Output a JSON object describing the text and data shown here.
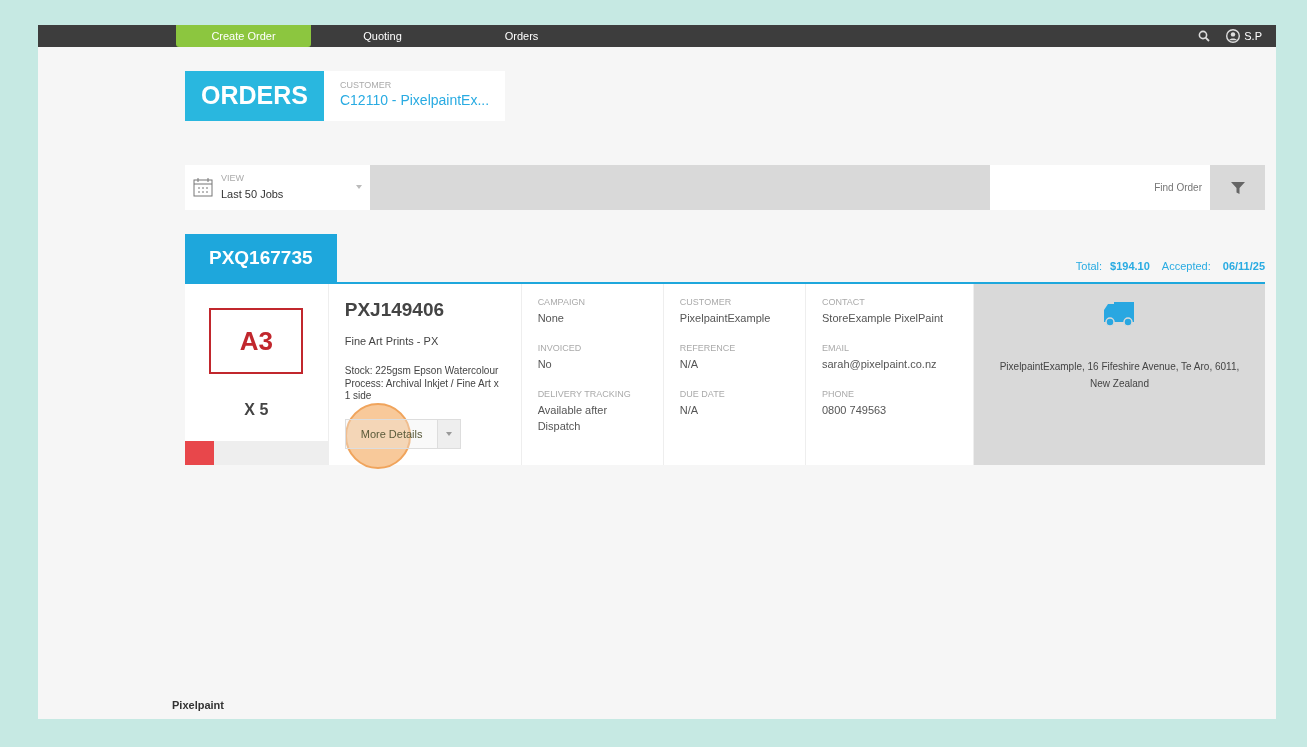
{
  "nav": {
    "items": [
      {
        "label": "Create Order",
        "selected": true
      },
      {
        "label": "Quoting",
        "selected": false
      },
      {
        "label": "Orders",
        "selected": false
      }
    ],
    "user": "S.P"
  },
  "header": {
    "title": "ORDERS",
    "customer_label": "CUSTOMER",
    "customer": "C12110 - PixelpaintEx..."
  },
  "toolbar": {
    "view_label": "VIEW",
    "view_value": "Last 50 Jobs",
    "search_placeholder": "Find Order"
  },
  "order": {
    "number": "PXQ167735",
    "total_label": "Total:",
    "total": "$194.10",
    "accepted_label": "Accepted:",
    "accepted": "06/11/25",
    "job": {
      "size": "A3",
      "quantity": "X 5",
      "number": "PXJ149406",
      "product": "Fine Art Prints - PX",
      "description": "Stock: 225gsm Epson Watercolour Process: Archival Inkjet / Fine Art x 1 side",
      "button": "More Details",
      "level": 0.2,
      "fields": [
        [
          {
            "label": "CAMPAIGN",
            "value": "None"
          },
          {
            "label": "INVOICED",
            "value": "No"
          },
          {
            "label": "DELIVERY TRACKING",
            "value": "Available after Dispatch"
          }
        ],
        [
          {
            "label": "CUSTOMER",
            "value": "PixelpaintExample"
          },
          {
            "label": "REFERENCE",
            "value": "N/A"
          },
          {
            "label": "DUE DATE",
            "value": "N/A"
          }
        ],
        [
          {
            "label": "CONTACT",
            "value": "StoreExample PixelPaint"
          },
          {
            "label": "EMAIL",
            "value": "sarah@pixelpaint.co.nz"
          },
          {
            "label": "PHONE",
            "value": "0800 749563"
          }
        ]
      ],
      "address": "PixelpaintExample, 16 Fifeshire Avenue, Te Aro, 6011, New Zealand"
    }
  },
  "footer": {
    "company": "Pixelpaint"
  }
}
